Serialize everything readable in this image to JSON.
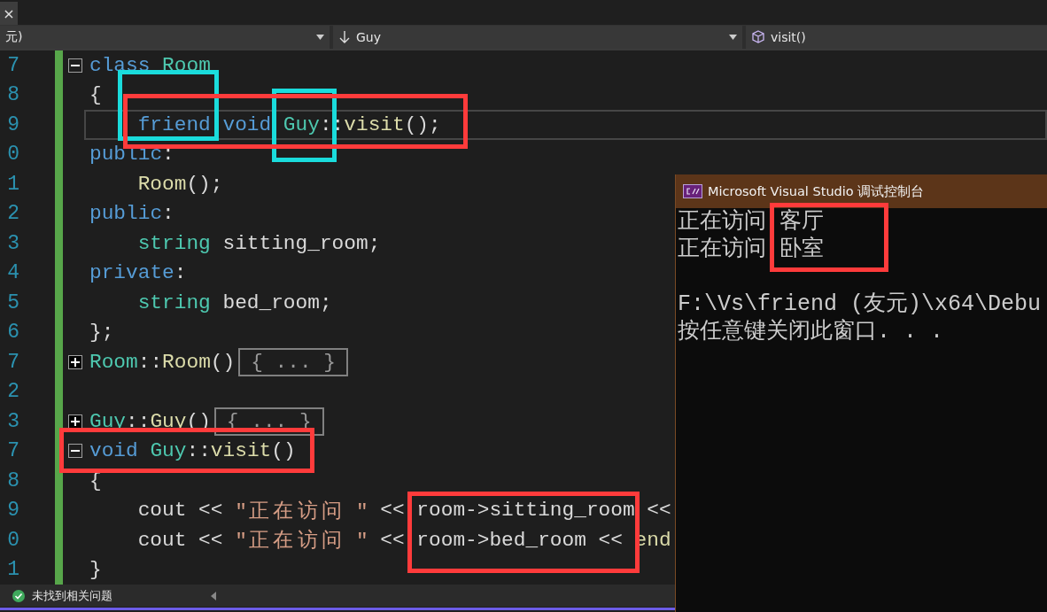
{
  "tab": {
    "close": "×"
  },
  "nav": [
    {
      "text": "元)"
    },
    {
      "text": "Guy"
    },
    {
      "text": "visit()"
    }
  ],
  "editor": {
    "lines": [
      {
        "number": "7",
        "current": false,
        "fold": {
          "expanded": true
        },
        "tokens": [
          {
            "kind": "keyword",
            "text": "class"
          },
          {
            "kind": "type",
            "text": " Room"
          }
        ]
      },
      {
        "number": "8",
        "current": false,
        "tokens": [
          {
            "kind": "plain",
            "text": "{"
          }
        ]
      },
      {
        "number": "9",
        "current": true,
        "indented": true,
        "tokens": [
          {
            "kind": "keyword",
            "text": "friend void"
          },
          {
            "kind": "type",
            "text": " Guy"
          },
          {
            "kind": "plain",
            "text": "::"
          },
          {
            "kind": "func",
            "text": "visit"
          },
          {
            "kind": "plain",
            "text": "();"
          }
        ]
      },
      {
        "number": "0",
        "current": false,
        "tokens": [
          {
            "kind": "keyword",
            "text": "public"
          },
          {
            "kind": "plain",
            "text": ":"
          }
        ]
      },
      {
        "number": "1",
        "current": false,
        "indented": true,
        "tokens": [
          {
            "kind": "func",
            "text": "Room"
          },
          {
            "kind": "plain",
            "text": "();"
          }
        ]
      },
      {
        "number": "2",
        "current": false,
        "tokens": [
          {
            "kind": "keyword",
            "text": "public"
          },
          {
            "kind": "plain",
            "text": ":"
          }
        ]
      },
      {
        "number": "3",
        "current": false,
        "indented": true,
        "tokens": [
          {
            "kind": "type",
            "text": "string"
          },
          {
            "kind": "plain",
            "text": " sitting_room;"
          }
        ]
      },
      {
        "number": "4",
        "current": false,
        "tokens": [
          {
            "kind": "keyword",
            "text": "private"
          },
          {
            "kind": "plain",
            "text": ":"
          }
        ]
      },
      {
        "number": "5",
        "current": false,
        "indented": true,
        "tokens": [
          {
            "kind": "type",
            "text": "string"
          },
          {
            "kind": "plain",
            "text": " bed_room;"
          }
        ]
      },
      {
        "number": "6",
        "current": false,
        "tokens": [
          {
            "kind": "plain",
            "text": "};"
          }
        ]
      },
      {
        "number": "7",
        "current": false,
        "fold": {
          "expanded": false
        },
        "collapsed": "{ ... }",
        "tokens": [
          {
            "kind": "type",
            "text": "Room"
          },
          {
            "kind": "plain",
            "text": "::"
          },
          {
            "kind": "func",
            "text": "Room"
          },
          {
            "kind": "plain",
            "text": "()"
          }
        ]
      },
      {
        "number": "2",
        "current": false
      },
      {
        "number": "3",
        "current": false,
        "fold": {
          "expanded": false
        },
        "collapsed": "{ ... }",
        "tokens": [
          {
            "kind": "type",
            "text": "Guy"
          },
          {
            "kind": "plain",
            "text": "::"
          },
          {
            "kind": "func",
            "text": "Guy"
          },
          {
            "kind": "plain",
            "text": "()"
          }
        ]
      },
      {
        "number": "7",
        "current": false,
        "fold": {
          "expanded": true
        },
        "tokens": [
          {
            "kind": "keyword",
            "text": "void"
          },
          {
            "kind": "type",
            "text": " Guy"
          },
          {
            "kind": "plain",
            "text": "::"
          },
          {
            "kind": "func",
            "text": "visit"
          },
          {
            "kind": "plain",
            "text": "()"
          }
        ]
      },
      {
        "number": "8",
        "current": false,
        "tokens": [
          {
            "kind": "plain",
            "text": "{"
          }
        ]
      },
      {
        "number": "9",
        "current": false,
        "indented": true,
        "tokens": [
          {
            "kind": "plain",
            "text": "cout << "
          },
          {
            "kind": "string",
            "text": "\"正在访问 \""
          },
          {
            "kind": "plain",
            "text": " << room->sitting_room <<"
          }
        ]
      },
      {
        "number": "0",
        "current": false,
        "indented": true,
        "tokens": [
          {
            "kind": "plain",
            "text": "cout << "
          },
          {
            "kind": "string",
            "text": "\"正在访问 \""
          },
          {
            "kind": "plain",
            "text": " << room->bed_room << "
          },
          {
            "kind": "func",
            "text": "end"
          }
        ]
      },
      {
        "number": "1",
        "current": false,
        "tokens": [
          {
            "kind": "plain",
            "text": "}"
          }
        ]
      }
    ]
  },
  "status": {
    "ok": true,
    "text": "未找到相关问题"
  },
  "console": {
    "title": "Microsoft Visual Studio 调试控制台",
    "output": [
      "正在访问 客厅",
      "正在访问 卧室"
    ],
    "footer": [
      "F:\\Vs\\friend (友元)\\x64\\Debu",
      "按任意键关闭此窗口. . ."
    ]
  },
  "annotations": [
    {
      "color": "#1adcdc"
    },
    {
      "color": "#1adcdc"
    },
    {
      "color": "#ff3b3b"
    },
    {
      "color": "#ff3b3b"
    },
    {
      "color": "#ff3b3b"
    },
    {
      "color": "#ff3b3b"
    }
  ]
}
